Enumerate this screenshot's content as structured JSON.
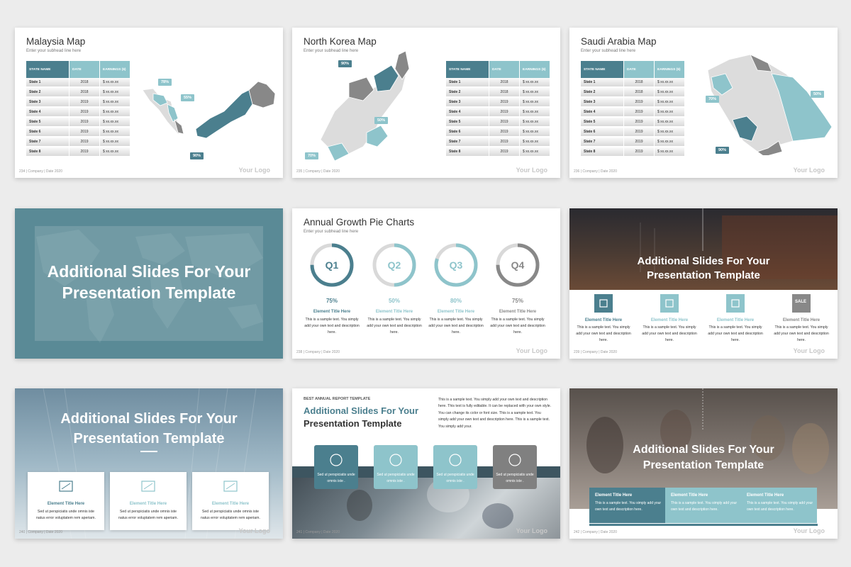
{
  "colors": {
    "teal_dark": "#4b7f8e",
    "teal_light": "#8ec4cb",
    "grey": "#888888",
    "bg": "#ececec"
  },
  "common": {
    "logo": "Your Logo",
    "subhead": "Enter your subhead line here",
    "company": "| Company | Date 2020"
  },
  "map_table": {
    "headers": [
      "STATE NAME",
      "DATE",
      "EARNINGS ($)"
    ],
    "rows": [
      [
        "State 1",
        "2018",
        "$ xx.xx.xx"
      ],
      [
        "State 2",
        "2018",
        "$ xx.xx.xx"
      ],
      [
        "State 3",
        "2019",
        "$ xx.xx.xx"
      ],
      [
        "State 4",
        "2019",
        "$ xx.xx.xx"
      ],
      [
        "State 5",
        "2019",
        "$ xx.xx.xx"
      ],
      [
        "State 6",
        "2019",
        "$ xx.xx.xx"
      ],
      [
        "State 7",
        "2019",
        "$ xx.xx.xx"
      ],
      [
        "State 8",
        "2019",
        "$ xx.xx.xx"
      ]
    ]
  },
  "slide1": {
    "title": "Malaysia Map",
    "page": "234",
    "callouts": [
      "78%",
      "55%",
      "90%"
    ]
  },
  "slide2": {
    "title": "North Korea Map",
    "page": "235",
    "callouts": [
      "90%",
      "50%",
      "70%"
    ]
  },
  "slide3": {
    "title": "Saudi Arabia Map",
    "page": "236",
    "callouts": [
      "70%",
      "50%",
      "90%"
    ]
  },
  "section": {
    "line1": "Additional Slides For Your",
    "line2": "Presentation Template"
  },
  "slide5": {
    "title": "Annual Growth Pie Charts",
    "page": "238",
    "items": [
      {
        "q": "Q1",
        "pct": "75%",
        "value": 0.75,
        "title": "Element Title Here"
      },
      {
        "q": "Q2",
        "pct": "50%",
        "value": 0.5,
        "title": "Element Title Here"
      },
      {
        "q": "Q3",
        "pct": "80%",
        "value": 0.8,
        "title": "Element Title Here"
      },
      {
        "q": "Q4",
        "pct": "75%",
        "value": 0.75,
        "title": "Element Title Here"
      }
    ],
    "desc": "This is a sample text. You simply add your own text and description here."
  },
  "slide6": {
    "page": "239",
    "items": [
      "Element Title Here",
      "Element Title Here",
      "Element Title Here",
      "Element Title Here"
    ],
    "desc": "This is a sample text. You simply add your own text and description here.",
    "sale": "SALE"
  },
  "slide7": {
    "page": "240",
    "items": [
      "Element Title Here",
      "Element Title Here",
      "Element Title Here"
    ],
    "desc": "Sed ut perspiciatis unde omnis iste natus error voluptatem rem aperiam."
  },
  "slide8": {
    "page": "241",
    "kicker": "BEST ANNUAL REPORT TEMPLATE",
    "title1": "Additional Slides For Your",
    "title2": "Presentation Template",
    "para": "This is a sample text. You simply add your own text and description here. This text is fully editable. It can be replaced with your own style. You can change its color or font size. This is a sample text. You simply add your own text and description here. This is a sample text. You simply add your.",
    "step": "Sed ut perspiciatis unde omnis iste ."
  },
  "slide9": {
    "page": "242",
    "items": [
      "Element Title Here",
      "Element Title Here",
      "Element Title Here"
    ],
    "desc": "This is a sample text. You simply add your own text and description here."
  }
}
